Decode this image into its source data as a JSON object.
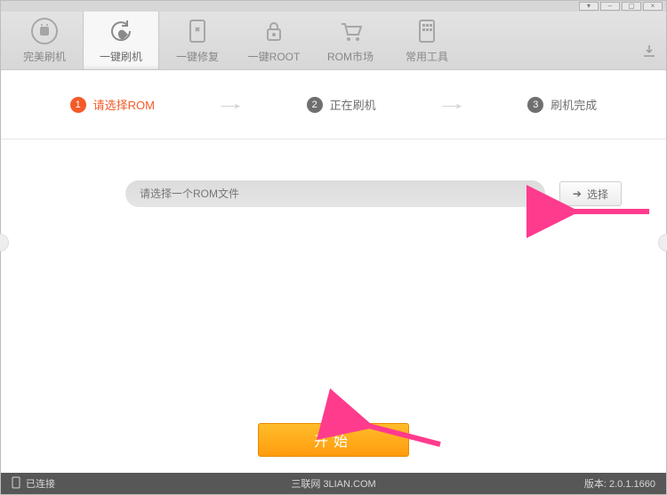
{
  "window": {
    "minimize": "–",
    "maximize": "▢",
    "close": "×"
  },
  "toolbar": {
    "items": [
      {
        "label": "完美刷机"
      },
      {
        "label": "一键刷机"
      },
      {
        "label": "一键修复"
      },
      {
        "label": "一键ROOT"
      },
      {
        "label": "ROM市场"
      },
      {
        "label": "常用工具"
      }
    ]
  },
  "steps": {
    "s1": {
      "num": "1",
      "label": "请选择ROM"
    },
    "s2": {
      "num": "2",
      "label": "正在刷机"
    },
    "s3": {
      "num": "3",
      "label": "刷机完成"
    }
  },
  "picker": {
    "placeholder": "请选择一个ROM文件",
    "select_label": "选择"
  },
  "start_label": "开始",
  "status": {
    "connected": "已连接",
    "watermark": "三联网 3LIAN.COM",
    "version": "版本: 2.0.1.1660"
  }
}
